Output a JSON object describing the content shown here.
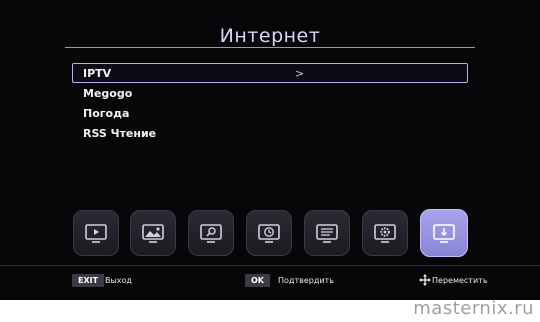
{
  "header": {
    "title": "Интернет"
  },
  "menu": {
    "items": [
      {
        "label": "IPTV",
        "selected": true
      },
      {
        "label": "Megogo"
      },
      {
        "label": "Погода"
      },
      {
        "label": "RSS Чтение"
      }
    ],
    "chevron": ">"
  },
  "dock": {
    "icons": [
      "tv-play-icon",
      "picture-icon",
      "search-icon",
      "clock-icon",
      "list-icon",
      "settings-icon",
      "internet-icon"
    ],
    "active_index": 6
  },
  "footer": {
    "exit_key": "EXIT",
    "exit_label": "Выход",
    "ok_key": "OK",
    "ok_label": "Подтвердить",
    "move_label": "Переместить"
  },
  "watermark": "masternix.ru",
  "colors": {
    "background": "#070709",
    "accent": "#a7a2ec",
    "highlight_border": "#b8b0ea"
  }
}
